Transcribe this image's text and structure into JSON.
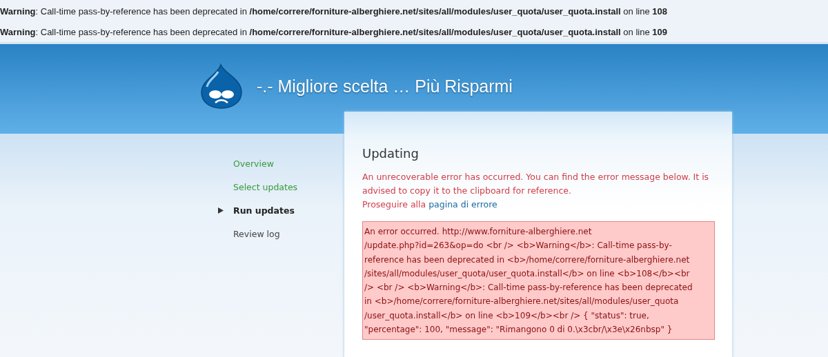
{
  "warnings": [
    "**Warning**: Call-time pass-by-reference has been deprecated in **/home/correre/forniture-alberghiere.net/sites/all/modules/user_quota/user_quota.install** on line **108**",
    "**Warning**: Call-time pass-by-reference has been deprecated in **/home/correre/forniture-alberghiere.net/sites/all/modules/user_quota/user_quota.install** on line **109**"
  ],
  "site": {
    "title": "-.- Migliore scelta … Più Risparmi"
  },
  "steps": [
    {
      "label": "Overview",
      "done": true,
      "selected": false
    },
    {
      "label": "Select updates",
      "done": true,
      "selected": false
    },
    {
      "label": "Run updates",
      "done": false,
      "selected": true
    },
    {
      "label": "Review log",
      "done": false,
      "selected": false
    }
  ],
  "page": {
    "title": "Updating",
    "message": "An unrecoverable error has occurred. You can find the error message below. It is advised to copy it to the clipboard for reference.",
    "continue_text": "Proseguire alla",
    "continue_link": "pagina di errore",
    "error_lines": [
      "An error occurred. http://www.forniture-alberghiere.net",
      "/update.php?id=263&op=do <br /> <b>Warning</b>: Call-time pass-by-",
      "reference has been deprecated in <b>/home/correre/forniture-alberghiere.net",
      "/sites/all/modules/user_quota/user_quota.install</b> on line <b>108</b><br",
      "/> <br /> <b>Warning</b>: Call-time pass-by-reference has been deprecated",
      "in <b>/home/correre/forniture-alberghiere.net/sites/all/modules/user_quota",
      "/user_quota.install</b> on line <b>109</b><br /> { \"status\": true,",
      "\"percentage\": 100, \"message\": \"Rimangono 0 di 0.\\x3cbr/\\x3e\\x26nbsp\" }"
    ]
  }
}
